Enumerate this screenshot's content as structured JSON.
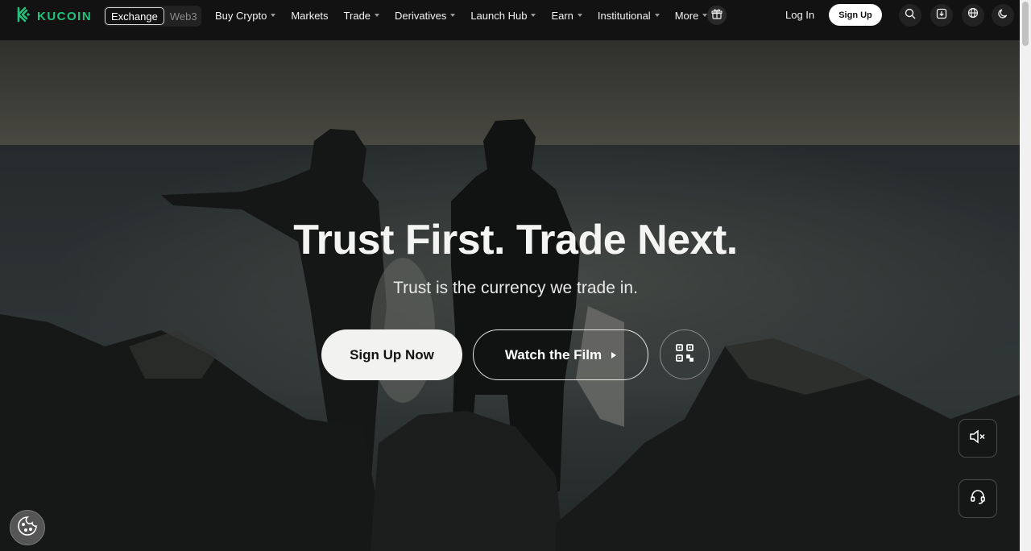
{
  "header": {
    "logo_text": "KUCOIN",
    "platform_switch": {
      "exchange_label": "Exchange",
      "web3_label": "Web3",
      "selected": "Exchange"
    },
    "nav": [
      {
        "label": "Buy Crypto",
        "has_dropdown": true
      },
      {
        "label": "Markets",
        "has_dropdown": false
      },
      {
        "label": "Trade",
        "has_dropdown": true
      },
      {
        "label": "Derivatives",
        "has_dropdown": true
      },
      {
        "label": "Launch Hub",
        "has_dropdown": true
      },
      {
        "label": "Earn",
        "has_dropdown": true
      },
      {
        "label": "Institutional",
        "has_dropdown": true
      },
      {
        "label": "More",
        "has_dropdown": true
      }
    ],
    "gift_icon": "gift-icon",
    "login_label": "Log In",
    "signup_label": "Sign Up",
    "icons": [
      "search-icon",
      "download-icon",
      "globe-icon",
      "moon-icon"
    ]
  },
  "hero": {
    "title": "Trust First. Trade Next.",
    "subtitle": "Trust is the currency we trade in.",
    "primary_button": "Sign Up Now",
    "secondary_button": "Watch the Film",
    "qr_icon": "qr-code-icon"
  },
  "floating": {
    "mute_icon": "volume-muted-icon",
    "support_icon": "headset-icon",
    "cookie_icon": "cookie-icon"
  },
  "colors": {
    "brand_green": "#23c17b",
    "header_bg": "#121212",
    "primary_button_bg": "#f2f2f0"
  }
}
